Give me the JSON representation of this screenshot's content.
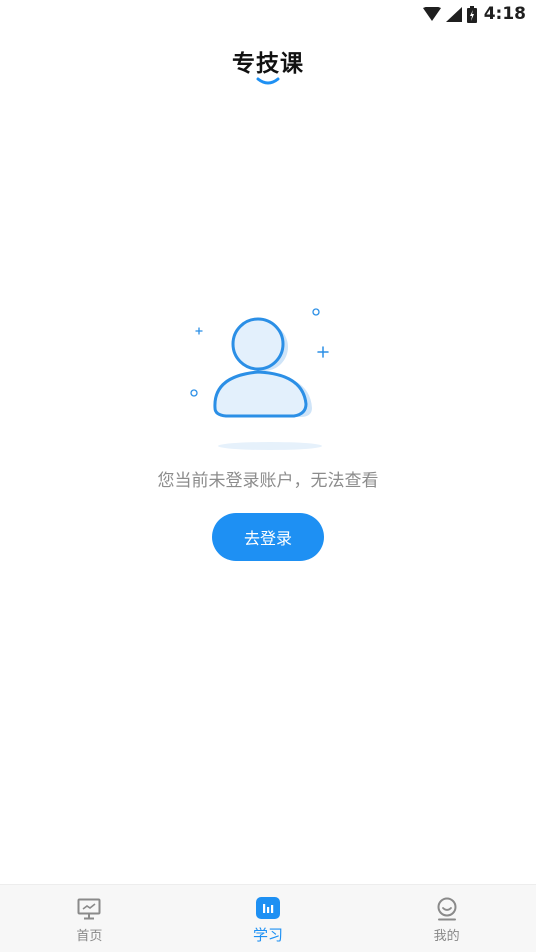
{
  "status_bar": {
    "time": "4:18",
    "icons": [
      "wifi-icon",
      "cell-signal-icon",
      "battery-charging-icon"
    ]
  },
  "header": {
    "title": "专技课"
  },
  "empty_state": {
    "illustration": "user-avatar-placeholder",
    "message": "您当前未登录账户，无法查看",
    "login_button_label": "去登录"
  },
  "bottom_nav": {
    "active": "study",
    "items": [
      {
        "key": "home",
        "label": "首页",
        "icon": "monitor-icon"
      },
      {
        "key": "study",
        "label": "学习",
        "icon": "study-chart-icon"
      },
      {
        "key": "mine",
        "label": "我的",
        "icon": "profile-icon"
      }
    ]
  },
  "colors": {
    "accent": "#1e90f3",
    "text_muted": "#8c8c8c",
    "nav_inactive": "#888888",
    "nav_background": "#f7f7f7"
  }
}
